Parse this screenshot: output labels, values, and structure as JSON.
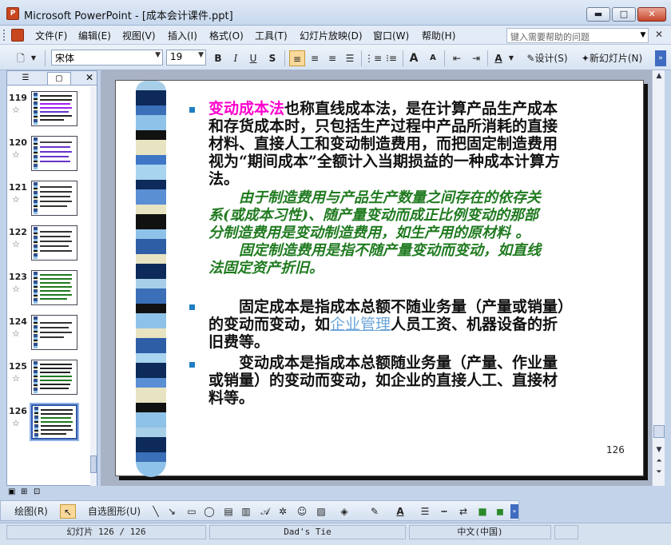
{
  "window": {
    "app_icon": "powerpoint-icon",
    "title": "Microsoft PowerPoint - [成本会计课件.ppt]",
    "min_glyph": "▬",
    "max_glyph": "□",
    "close_glyph": "✕"
  },
  "menubar": {
    "items": [
      "文件(F)",
      "编辑(E)",
      "视图(V)",
      "插入(I)",
      "格式(O)",
      "工具(T)",
      "幻灯片放映(D)",
      "窗口(W)",
      "帮助(H)"
    ],
    "help_placeholder": "键入需要帮助的问题",
    "close_glyph": "✕"
  },
  "toolbar": {
    "font_name": "宋体",
    "font_size": "19",
    "bold": "B",
    "italic": "I",
    "underline": "U",
    "shadow": "S",
    "font_color_glyph": "A",
    "grow_font": "A",
    "shrink_font": "A",
    "design_label": "设计(S)",
    "new_slide_label": "新幻灯片(N)"
  },
  "panel": {
    "close_glyph": "✕",
    "thumbnails": [
      {
        "num": "119"
      },
      {
        "num": "120"
      },
      {
        "num": "121"
      },
      {
        "num": "122"
      },
      {
        "num": "123"
      },
      {
        "num": "124"
      },
      {
        "num": "125"
      },
      {
        "num": "126"
      }
    ],
    "star_glyph": "☆"
  },
  "slide": {
    "para1_term": "变动成本法",
    "para1_rest_l1": "也称直线成本法，是在计算产品生产成本",
    "para1_l2": "和存货成本时，只包括生产过程中产品所消耗的直接",
    "para1_l3": "材料、直接人工和变动制造费用，而把固定制造费用",
    "para1_l4": "视为“期间成本”全额计入当期损益的一种成本计算方",
    "para1_l5": "法。",
    "green_l1": "由于制造费用与产品生产数量之间存在的依存关",
    "green_l2": "系(或成本习性)、随产量变动而成正比例变动的那部",
    "green_l3": "分制造费用是变动制造费用，如生产用的原材料 。",
    "green_l4": "固定制造费用是指不随产量变动而变动，如直线",
    "green_l5": "法固定资产折旧。",
    "para2_l1": "固定成本是指成本总额不随业务量（产量或销量）",
    "para2_l2a": "的变动而变动，如",
    "para2_link": "企业管理",
    "para2_l2b": "人员工资、机器设备的折",
    "para2_l3": "旧费等。",
    "para3_l1": "变动成本是指成本总额随业务量（产量、作业量",
    "para3_l2": "或销量）的变动而变动，如企业的直接人工、直接材",
    "para3_l3": "料等。",
    "page_number": "126"
  },
  "drawbar": {
    "draw_label": "绘图(R)",
    "autoshapes_label": "自选图形(U)"
  },
  "status": {
    "slide_info": "幻灯片 126 / 126",
    "design": "Dad's Tie",
    "language": "中文(中国)"
  },
  "colors": {
    "accent_term": "#ff00cc",
    "green_text": "#1f7a1f",
    "bullet": "#1f7fc2",
    "link": "#6aa4d8"
  }
}
